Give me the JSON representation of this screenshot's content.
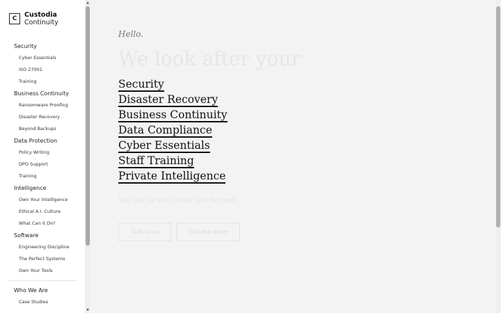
{
  "logo": {
    "mark": "C",
    "line1": "Custodia",
    "line2": "Continuity"
  },
  "sidebar": {
    "groups": [
      {
        "label": "Security",
        "items": [
          "Cyber Essentials",
          "ISO 27001",
          "Training"
        ]
      },
      {
        "label": "Business Continuity",
        "items": [
          "Ransomware Proofing",
          "Disaster Recovery",
          "Beyond Backups"
        ]
      },
      {
        "label": "Data Protection",
        "items": [
          "Policy Writing",
          "DPO Support",
          "Training"
        ]
      },
      {
        "label": "Intelligence",
        "items": [
          "Own Your Intelligence",
          "Ethical A.I. Culture",
          "What Can it Do?"
        ]
      },
      {
        "label": "Software",
        "items": [
          "Engineering Discipline",
          "The Perfect Systems",
          "Own Your Tools"
        ]
      },
      {
        "label": "Who We Are",
        "items": [
          "Case Studies"
        ]
      }
    ]
  },
  "main": {
    "greeting": "Hello.",
    "headline": "We look after your",
    "topics": [
      "Security",
      "Disaster Recovery",
      "Business Continuity",
      "Data Compliance",
      "Cyber Essentials",
      "Staff Training",
      "Private Intelligence"
    ],
    "tagline": "You get on with what you do best.",
    "buttons": {
      "primary": "Talk to us",
      "secondary": "Tell me more"
    }
  },
  "scrollbars": {
    "up_arrow": "▲",
    "down_arrow": "▼"
  }
}
